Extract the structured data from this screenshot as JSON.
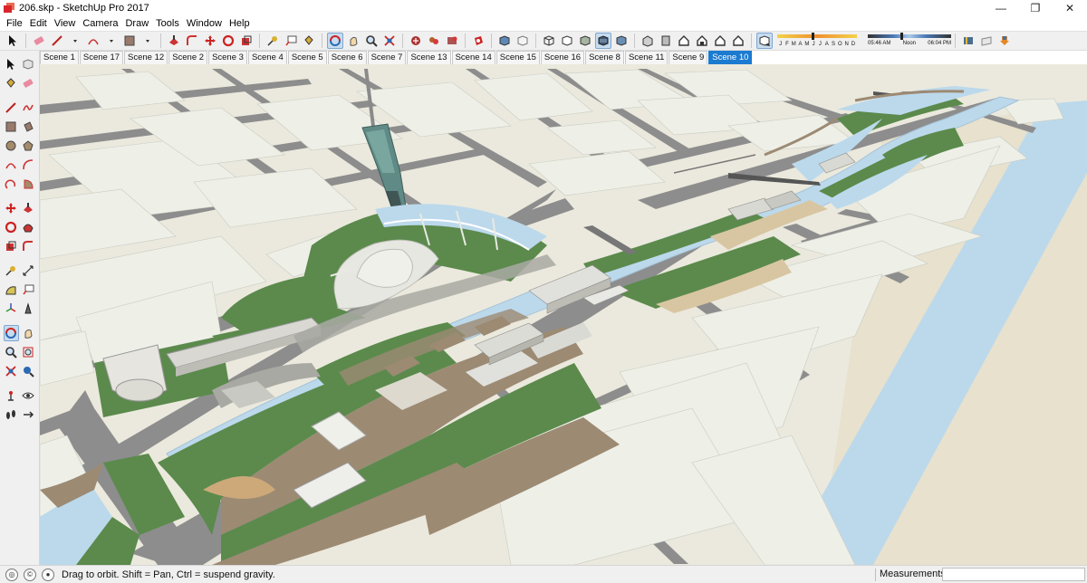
{
  "window": {
    "title": "206.skp - SketchUp Pro 2017",
    "controls": {
      "minimize": "—",
      "maximize": "❐",
      "close": "✕"
    }
  },
  "menu": [
    "File",
    "Edit",
    "View",
    "Camera",
    "Draw",
    "Tools",
    "Window",
    "Help"
  ],
  "shadows": {
    "months": [
      "J",
      "F",
      "M",
      "A",
      "M",
      "J",
      "J",
      "A",
      "S",
      "O",
      "N",
      "D"
    ],
    "time_start": "05:46 AM",
    "time_mid": "Noon",
    "time_end": "06:04 PM"
  },
  "scenes": {
    "tabs": [
      "Scene 1",
      "Scene 17",
      "Scene 12",
      "Scene 2",
      "Scene 3",
      "Scene 4",
      "Scene 5",
      "Scene 6",
      "Scene 7",
      "Scene 13",
      "Scene 14",
      "Scene 15",
      "Scene 16",
      "Scene 8",
      "Scene 11",
      "Scene 9",
      "Scene 10"
    ],
    "active": "Scene 10"
  },
  "status": {
    "hint": "Drag to orbit. Shift = Pan, Ctrl = suspend gravity.",
    "measurements_label": "Measurements",
    "measurements_value": ""
  },
  "colors": {
    "ground": "#ebe9dd",
    "block": "#eef0e8",
    "road": "#8d8d8d",
    "water": "#bcd9ec",
    "grass": "#5b8a4c",
    "plaza": "#9c8a73",
    "active_tab": "#1b7bd1"
  }
}
